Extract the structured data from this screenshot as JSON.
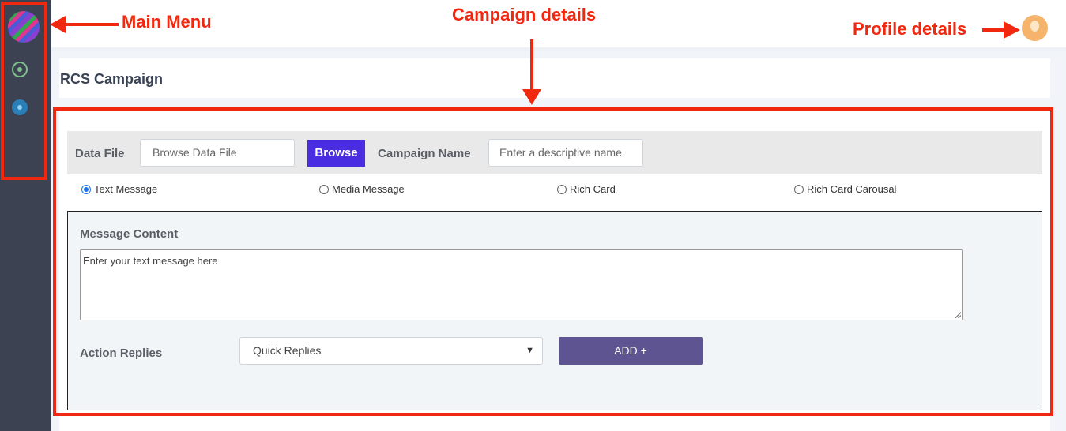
{
  "sidebar": {
    "icons": [
      "app-logo",
      "whatsapp-icon",
      "gear-icon"
    ]
  },
  "page": {
    "title": "RCS Campaign"
  },
  "form": {
    "data_file_label": "Data File",
    "data_file_placeholder": "Browse Data File",
    "browse_label": "Browse",
    "campaign_name_label": "Campaign Name",
    "campaign_name_placeholder": "Enter a descriptive name",
    "message_types": [
      {
        "label": "Text Message",
        "checked": true
      },
      {
        "label": "Media Message",
        "checked": false
      },
      {
        "label": "Rich Card",
        "checked": false
      },
      {
        "label": "Rich Card Carousal",
        "checked": false
      }
    ],
    "message_content_label": "Message Content",
    "message_placeholder": "Enter your text message here",
    "action_replies_label": "Action Replies",
    "action_replies_selected": "Quick Replies",
    "add_label": "ADD +"
  },
  "annotations": {
    "main_menu": "Main Menu",
    "campaign_details": "Campaign details",
    "profile_details": "Profile details",
    "color": "#f0280f"
  },
  "colors": {
    "sidebar": "#3d4252",
    "browse_button": "#4a2de0",
    "add_button": "#5f5492"
  }
}
